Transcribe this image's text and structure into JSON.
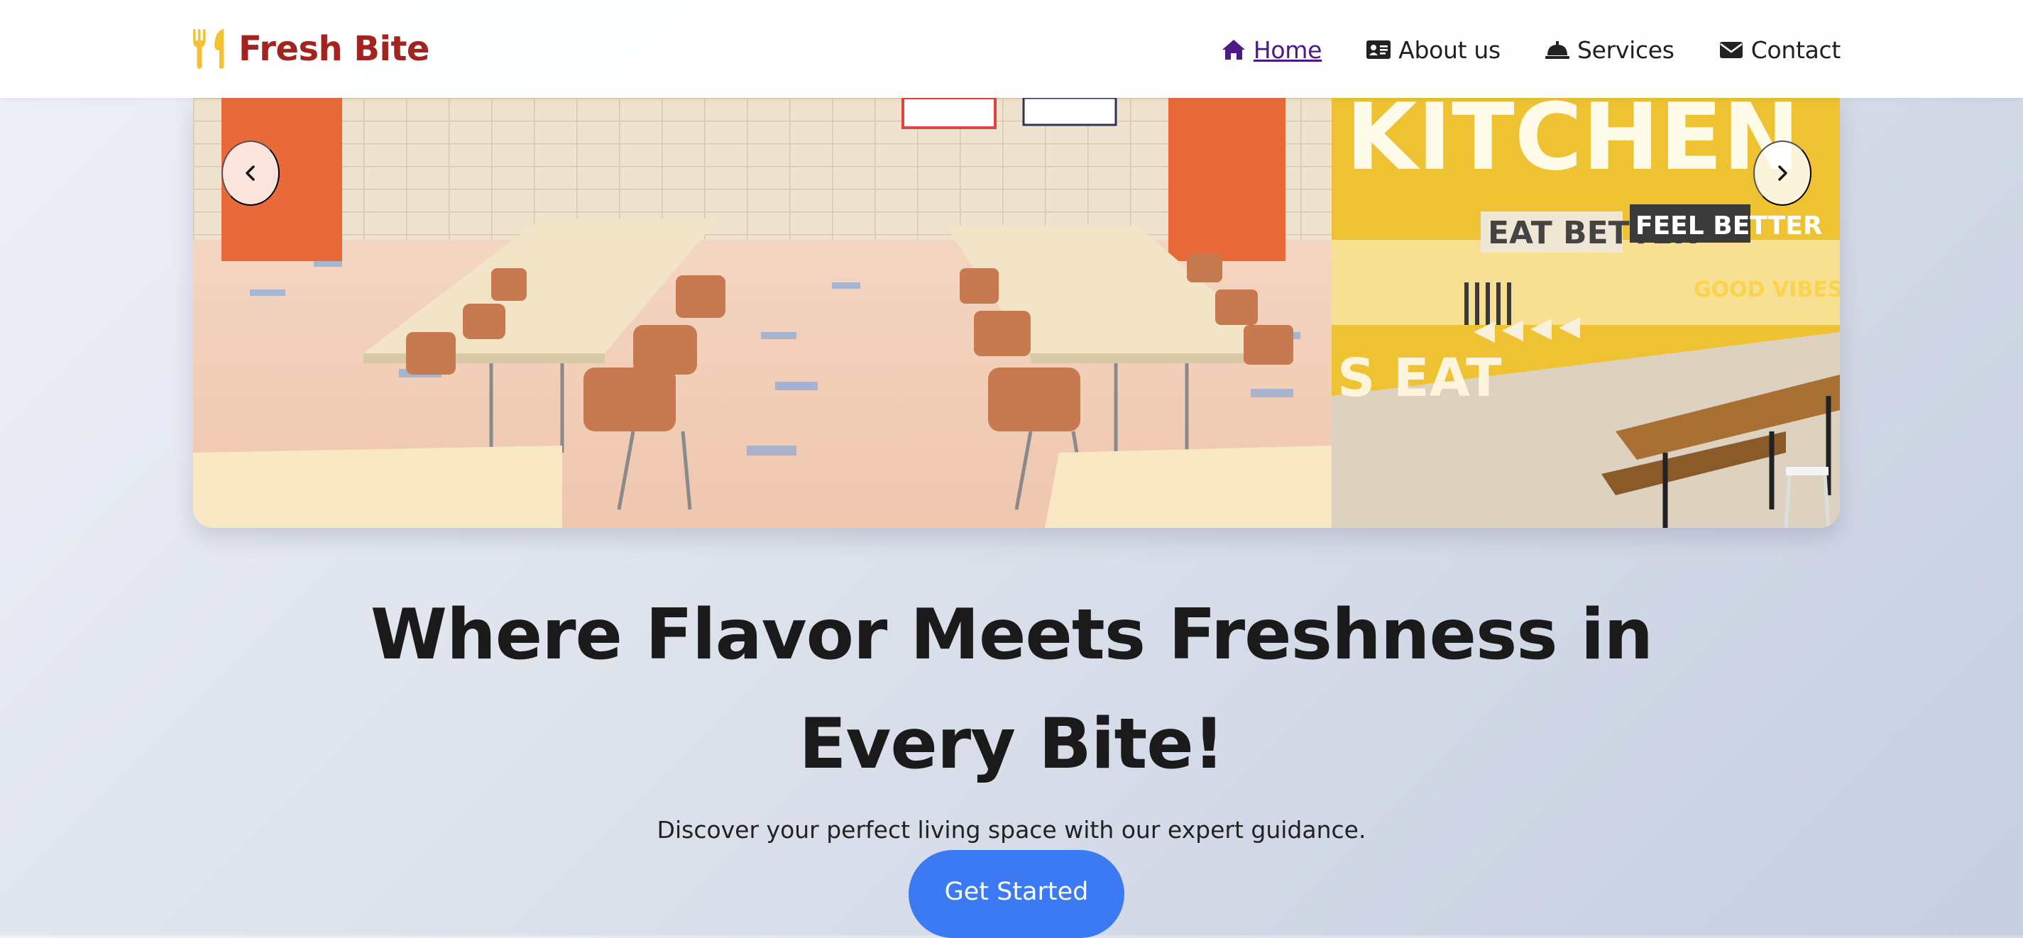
{
  "brand": {
    "name": "Fresh Bite",
    "icon": "fork-knife-icon",
    "name_color": "#a3231f",
    "icon_color": "#f2c232"
  },
  "nav": {
    "items": [
      {
        "label": " Home",
        "icon": "home-icon",
        "active": true
      },
      {
        "label": "About us",
        "icon": "id-card-icon",
        "active": false
      },
      {
        "label": "Services",
        "icon": "service-bell-icon",
        "active": false
      },
      {
        "label": "Contact",
        "icon": "envelope-icon",
        "active": false
      }
    ],
    "active_color": "#4b1a86"
  },
  "carousel": {
    "prev_icon": "chevron-left-icon",
    "next_icon": "chevron-right-icon",
    "slides": [
      {
        "scene": "cafeteria-tables-orange-doors"
      },
      {
        "scene": "kitchen-loft-yellow-mural",
        "mural_text": [
          "KITCHEN LOFT",
          "EAT BETTER",
          "FEEL BETTER",
          "GOOD VIBES ONLY",
          "S EAT"
        ]
      }
    ]
  },
  "hero": {
    "headline": "Where Flavor Meets Freshness in Every Bite!",
    "subline": "Discover your perfect living space with our expert guidance.",
    "cta_label": "Get Started",
    "cta_color": "#3b7af2"
  }
}
